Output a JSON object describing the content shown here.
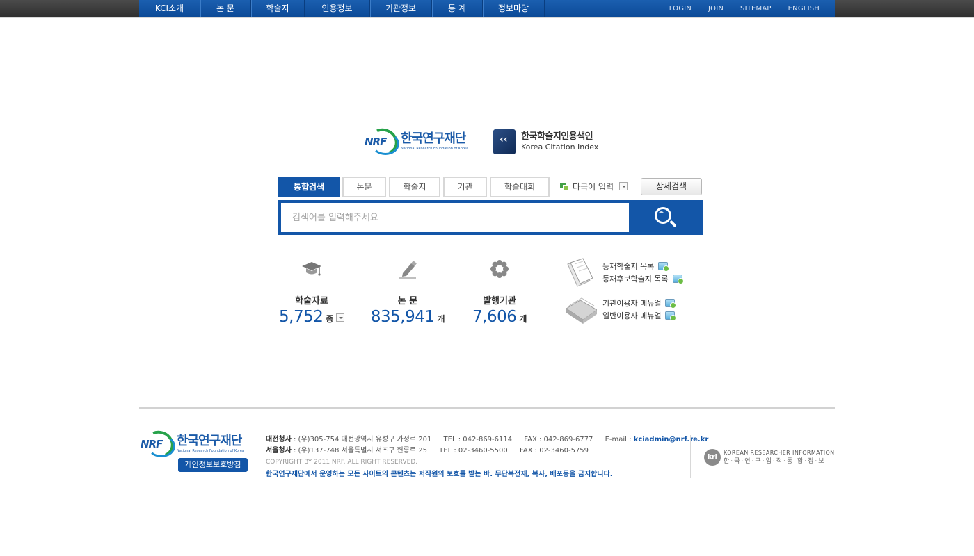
{
  "nav": {
    "menu": [
      "KCI소개",
      "논 문",
      "학술지",
      "인용정보",
      "기관정보",
      "통 계",
      "정보마당"
    ],
    "util": [
      "LOGIN",
      "JOIN",
      "SITEMAP",
      "ENGLISH"
    ]
  },
  "logos": {
    "nrf_mark": "NRF",
    "nrf_ko": "한국연구재단",
    "nrf_en": "National Research Foundation of Korea",
    "kci_ko": "한국학술지인용색인",
    "kci_en": "Korea Citation Index"
  },
  "search": {
    "tabs": [
      "통합검색",
      "논문",
      "학술지",
      "기관",
      "학술대회"
    ],
    "active_tab": "통합검색",
    "multilang_label": "다국어 입력",
    "advanced_label": "상세검색",
    "placeholder": "검색어를 입력해주세요",
    "value": ""
  },
  "stats": [
    {
      "label": "학술자료",
      "value": "5,752",
      "unit": "종",
      "icon": "graduation-cap-icon"
    },
    {
      "label": "논 문",
      "value": "835,941",
      "unit": "개",
      "icon": "pen-writing-icon"
    },
    {
      "label": "발행기관",
      "value": "7,606",
      "unit": "개",
      "icon": "gear-flower-icon"
    }
  ],
  "links": {
    "group1": [
      "등재학술지 목록",
      "등재후보학술지 목록"
    ],
    "group2": [
      "기관이용자 메뉴얼",
      "일반이용자 메뉴얼"
    ]
  },
  "footer": {
    "privacy": "개인정보보호방침",
    "daejeon_label": "대전청사",
    "daejeon_addr": ": (우)305-754 대전광역시 유성구 가정로 201",
    "daejeon_tel": "TEL : 042-869-6114",
    "daejeon_fax": "FAX : 042-869-6777",
    "email_label": "E-mail :",
    "email": "kciadmin@nrf.re.kr",
    "seoul_label": "서울청사",
    "seoul_addr": ": (우)137-748 서울특별시 서초구 헌릉로 25",
    "seoul_tel": "TEL : 02-3460-5500",
    "seoul_fax": "FAX : 02-3460-5759",
    "copyright": "COPYRIGHT BY 2011 NRF. ALL RIGHT RESERVED.",
    "notice": "한국연구재단에서 운영하는 모든 사이트의 콘텐츠는 저작원의 보호를 받는 바. 무단복전재, 복사, 배포등을 금지합니다.",
    "kri_mark": "kri",
    "kri_en": "KOREAN RESEARCHER INFORMATION",
    "kri_ko": "한·국·연·구·업·적·통·합·정·보"
  },
  "colors": {
    "brand_blue": "#1356a8",
    "nav_dark": "#333333",
    "green": "#27a24a"
  }
}
